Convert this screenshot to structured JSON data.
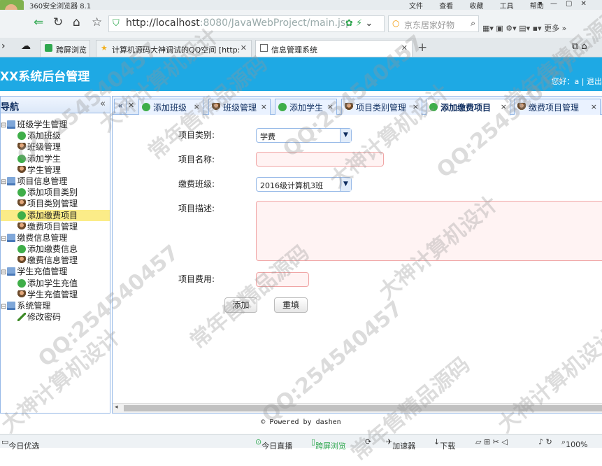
{
  "browser": {
    "app_name": "360安全浏览器 8.1",
    "menus": [
      "文件",
      "查看",
      "收藏",
      "工具",
      "帮助"
    ],
    "url_host": "http://localhost",
    "url_rest": ":8080/JavaWebProject/main.jsp",
    "search_placeholder": "京东居家好物",
    "more_label": "更多",
    "tabs": [
      {
        "label": "跨屏浏览",
        "active": false
      },
      {
        "label": "计算机源码大神调试的QQ空间 [http:",
        "active": false
      },
      {
        "label": "信息管理系统",
        "active": true
      }
    ],
    "status": {
      "left": "今日优选",
      "live": "今日直播",
      "cross": "跨屏浏览",
      "accel": "加速器",
      "download": "下载",
      "zoom": "100%"
    }
  },
  "app": {
    "title": "XX系统后台管理",
    "user_info": "您好：a | 退出",
    "footer": "© Powered by dashen"
  },
  "sidebar": {
    "title": "导航",
    "collapse_icon": "«",
    "tree": [
      {
        "label": "班级学生管理",
        "level": 0,
        "icon": "folder-icon"
      },
      {
        "label": "添加班级",
        "level": 1,
        "icon": "add-icon"
      },
      {
        "label": "班级管理",
        "level": 1,
        "icon": "user-icon"
      },
      {
        "label": "添加学生",
        "level": 1,
        "icon": "add-icon"
      },
      {
        "label": "学生管理",
        "level": 1,
        "icon": "user-icon"
      },
      {
        "label": "项目信息管理",
        "level": 0,
        "icon": "folder-icon"
      },
      {
        "label": "添加项目类别",
        "level": 1,
        "icon": "add-icon"
      },
      {
        "label": "项目类别管理",
        "level": 1,
        "icon": "user-icon"
      },
      {
        "label": "添加缴费项目",
        "level": 1,
        "icon": "add-icon",
        "selected": true
      },
      {
        "label": "缴费项目管理",
        "level": 1,
        "icon": "user-icon"
      },
      {
        "label": "缴费信息管理",
        "level": 0,
        "icon": "folder-icon"
      },
      {
        "label": "添加缴费信息",
        "level": 1,
        "icon": "add-icon"
      },
      {
        "label": "缴费信息管理",
        "level": 1,
        "icon": "user-icon"
      },
      {
        "label": "学生充值管理",
        "level": 0,
        "icon": "folder-icon"
      },
      {
        "label": "添加学生充值",
        "level": 1,
        "icon": "add-icon"
      },
      {
        "label": "学生充值管理",
        "level": 1,
        "icon": "user-icon"
      },
      {
        "label": "系统管理",
        "level": 0,
        "icon": "folder-icon"
      },
      {
        "label": "修改密码",
        "level": 1,
        "icon": "pen-icon"
      }
    ]
  },
  "page_tabs": [
    {
      "label": "添加班级",
      "icon": "add-icon",
      "active": false
    },
    {
      "label": "班级管理",
      "icon": "user-icon",
      "active": false
    },
    {
      "label": "添加学生",
      "icon": "add-icon",
      "active": false
    },
    {
      "label": "项目类别管理",
      "icon": "user-icon",
      "active": false
    },
    {
      "label": "添加缴费项目",
      "icon": "add-icon",
      "active": true
    },
    {
      "label": "缴费项目管理",
      "icon": "user-icon",
      "active": false
    }
  ],
  "form": {
    "type_label": "项目类别:",
    "type_value": "学费",
    "name_label": "项目名称:",
    "name_value": "",
    "class_label": "缴费班级:",
    "class_value": "2016级计算机3班",
    "desc_label": "项目描述:",
    "desc_value": "",
    "fee_label": "项目费用:",
    "fee_value": "",
    "add_button": "添加",
    "reset_button": "重填"
  },
  "watermarks": [
    "QQ:254540457",
    "大神计算机设计",
    "常年售精品源码"
  ],
  "colors": {
    "header": "#1ea9e4",
    "panel_border": "#95b8e7",
    "selected_node": "#fbec88"
  }
}
